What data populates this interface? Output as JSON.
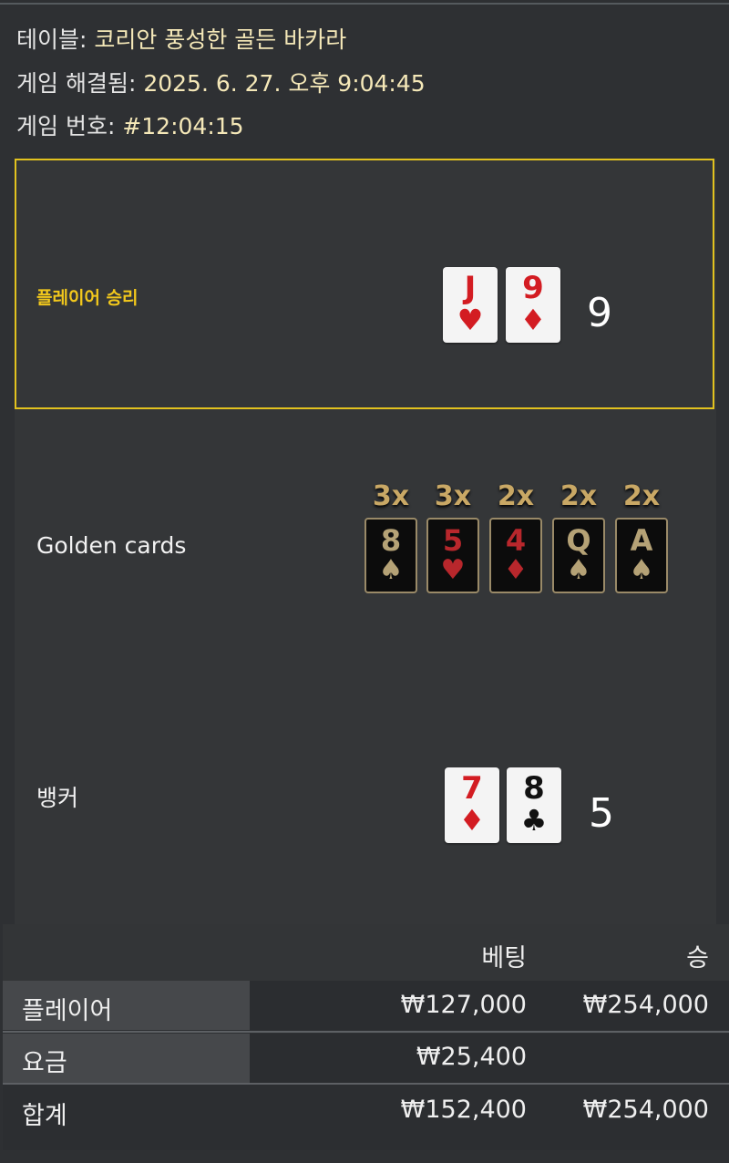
{
  "header": {
    "table_key": "테이블:",
    "table_value": "코리안 풍성한 골든 바카라",
    "resolved_key": "게임 해결됨:",
    "resolved_value": "2025. 6. 27. 오후 9:04:45",
    "game_no_key": "게임 번호:",
    "game_no_value": "#12:04:15"
  },
  "player": {
    "label": "플레이어 승리",
    "cards": [
      {
        "rank": "J",
        "suit": "♥",
        "color": "#d31c22"
      },
      {
        "rank": "9",
        "suit": "♦",
        "color": "#d31c22"
      }
    ],
    "score": "9"
  },
  "golden": {
    "label": "Golden cards",
    "cards": [
      {
        "mult": "3x",
        "rank": "8",
        "suit": "♠",
        "color": "#b5a276"
      },
      {
        "mult": "3x",
        "rank": "5",
        "suit": "♥",
        "color": "#b8272c"
      },
      {
        "mult": "2x",
        "rank": "4",
        "suit": "♦",
        "color": "#b8272c"
      },
      {
        "mult": "2x",
        "rank": "Q",
        "suit": "♠",
        "color": "#b5a276"
      },
      {
        "mult": "2x",
        "rank": "A",
        "suit": "♠",
        "color": "#b5a276"
      }
    ]
  },
  "banker": {
    "label": "뱅커",
    "cards": [
      {
        "rank": "7",
        "suit": "♦",
        "color": "#d31c22"
      },
      {
        "rank": "8",
        "suit": "♣",
        "color": "#111111"
      }
    ],
    "score": "5"
  },
  "bets": {
    "col_bet": "베팅",
    "col_win": "승",
    "rows": [
      {
        "label": "플레이어",
        "bet": "₩127,000",
        "win": "₩254,000"
      },
      {
        "label": "요금",
        "bet": "₩25,400",
        "win": ""
      }
    ],
    "total": {
      "label": "합계",
      "bet": "₩152,400",
      "win": "₩254,000"
    }
  },
  "colors": {
    "accent_gold": "#e2c21f",
    "background": "#2e3033"
  }
}
